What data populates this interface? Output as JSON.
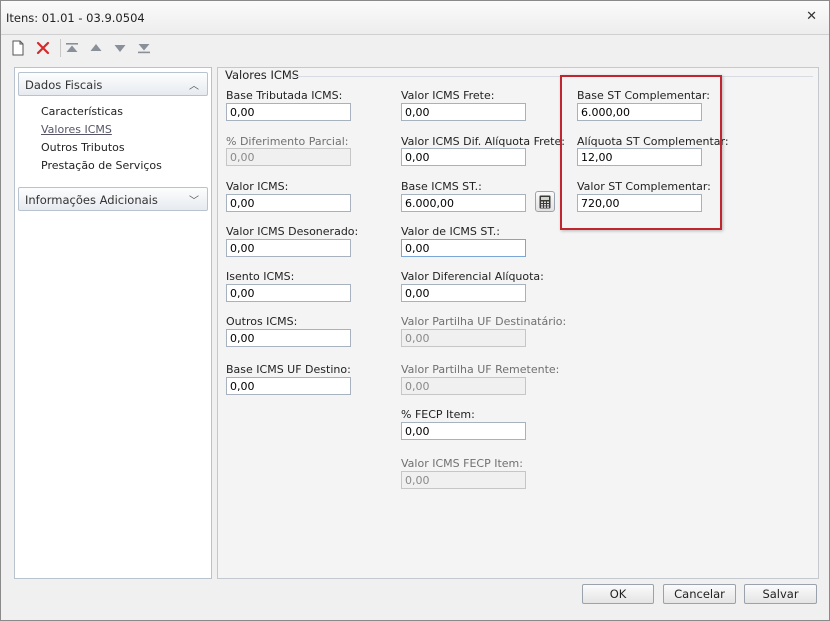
{
  "window": {
    "title": "Itens: 01.01 - 03.9.0504"
  },
  "toolbar": {
    "icons": [
      "new-document-icon",
      "delete-icon",
      "move-first-icon",
      "move-up-icon",
      "move-down-icon",
      "move-last-icon"
    ],
    "delete_color": "#d42a2a"
  },
  "nav": {
    "section1": "Dados Fiscais",
    "items": [
      "Características",
      "Valores ICMS",
      "Outros Tributos",
      "Prestação de Serviços"
    ],
    "selected": "Valores ICMS",
    "section2": "Informações Adicionais"
  },
  "group": {
    "title": "Valores ICMS"
  },
  "col1": [
    {
      "label": "Base Tributada ICMS:",
      "value": "0,00",
      "disabled": false
    },
    {
      "label": "% Diferimento Parcial:",
      "value": "0,00",
      "disabled": true
    },
    {
      "label": "Valor ICMS:",
      "value": "0,00",
      "disabled": false
    },
    {
      "label": "Valor ICMS Desonerado:",
      "value": "0,00",
      "disabled": false
    },
    {
      "label": "Isento ICMS:",
      "value": "0,00",
      "disabled": false
    },
    {
      "label": "Outros ICMS:",
      "value": "0,00",
      "disabled": false
    },
    {
      "label": "Base ICMS UF Destino:",
      "value": "0,00",
      "disabled": false
    }
  ],
  "col2": [
    {
      "label": "Valor ICMS Frete:",
      "value": "0,00",
      "disabled": false
    },
    {
      "label": "Valor ICMS Dif. Alíquota Frete:",
      "value": "0,00",
      "disabled": false
    },
    {
      "label": "Base ICMS ST.:",
      "value": "6.000,00",
      "disabled": false
    },
    {
      "label": "Valor de ICMS ST.:",
      "value": "0,00",
      "disabled": false
    },
    {
      "label": "Valor Diferencial Alíquota:",
      "value": "0,00",
      "disabled": false
    },
    {
      "label": "Valor Partilha UF Destinatário:",
      "value": "0,00",
      "disabled": true
    },
    {
      "label": "Valor Partilha UF Remetente:",
      "value": "0,00",
      "disabled": true
    },
    {
      "label": "% FECP Item:",
      "value": "0,00",
      "disabled": false
    },
    {
      "label": "Valor ICMS FECP Item:",
      "value": "0,00",
      "disabled": true
    }
  ],
  "col3": [
    {
      "label": "Base ST Complementar:",
      "value": "6.000,00",
      "disabled": false
    },
    {
      "label": "Alíquota ST Complementar:",
      "value": "12,00",
      "disabled": false
    },
    {
      "label": "Valor ST Complementar:",
      "value": "720,00",
      "disabled": false
    }
  ],
  "highlight_color": "#c0262d",
  "buttons": {
    "ok": "OK",
    "cancel": "Cancelar",
    "save": "Salvar"
  }
}
